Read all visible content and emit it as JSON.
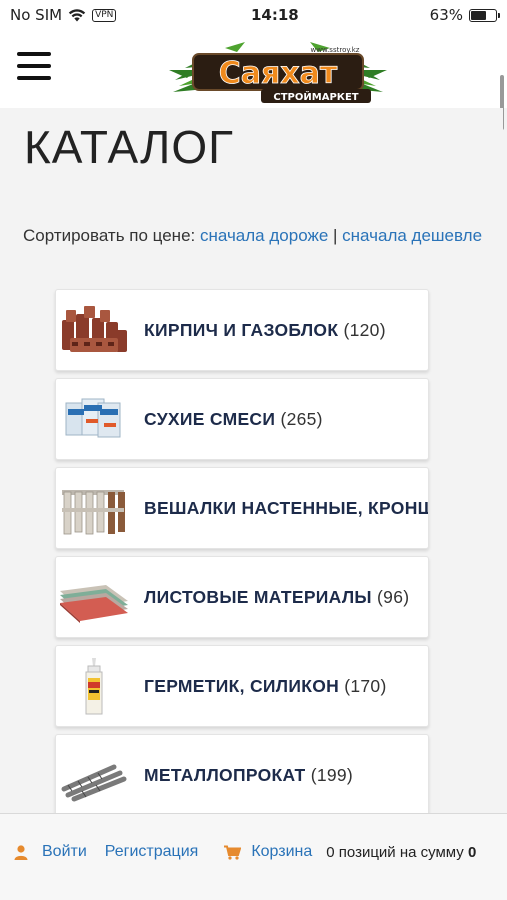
{
  "status_bar": {
    "carrier": "No SIM",
    "vpn": "VPN",
    "time": "14:18",
    "battery": "63%",
    "battery_level": 0.63
  },
  "header": {
    "logo_text": "Саяхат",
    "logo_subtitle": "СТРОЙМАРКЕТ",
    "logo_url_text": "www.sstroy.kz"
  },
  "page": {
    "title": "КАТАЛОГ"
  },
  "sort": {
    "label": "Сортировать по цене:",
    "expensive_first": "сначала дороже",
    "separator": "|",
    "cheap_first": "сначала дешевле"
  },
  "categories": [
    {
      "name": "КИРПИЧ И ГАЗОБЛОК",
      "count": "(120)",
      "icon": "brick-icon"
    },
    {
      "name": "СУХИЕ СМЕСИ",
      "count": "(265)",
      "icon": "dry-mix-bags-icon"
    },
    {
      "name": "ВЕШАЛКИ НАСТЕННЫЕ, КРОНШТЕЙНЫ",
      "count": "",
      "icon": "wall-hanger-icon"
    },
    {
      "name": "ЛИСТОВЫЕ МАТЕРИАЛЫ",
      "count": "(96)",
      "icon": "sheet-material-icon"
    },
    {
      "name": "ГЕРМЕТИК, СИЛИКОН",
      "count": "(170)",
      "icon": "sealant-tube-icon"
    },
    {
      "name": "МЕТАЛЛОПРОКАТ",
      "count": "(199)",
      "icon": "rebar-icon"
    }
  ],
  "bottom_bar": {
    "login": "Войти",
    "register": "Регистрация",
    "cart": "Корзина",
    "cart_summary_prefix": "0 позиций на сумму",
    "cart_summary_value": "0"
  },
  "colors": {
    "link": "#2a73b8",
    "category_text": "#1d2b4a",
    "icon_orange": "#e68a2e",
    "logo_orange": "#f08a1c"
  }
}
